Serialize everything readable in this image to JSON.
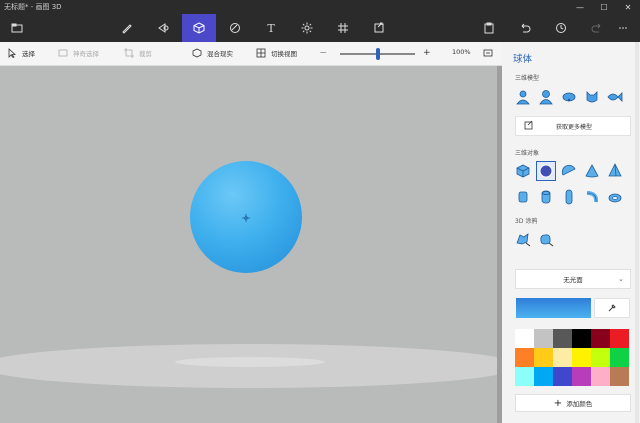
{
  "window": {
    "title": "无标题* - 画图 3D",
    "controls": [
      "—",
      "☐",
      "✕"
    ]
  },
  "toolbar": {
    "tools": [
      {
        "name": "menu",
        "icon": "folder-icon"
      },
      {
        "name": "brushes",
        "icon": "brush-icon"
      },
      {
        "name": "2d-shapes",
        "icon": "shapes-2d-icon"
      },
      {
        "name": "3d-shapes",
        "icon": "cube-icon",
        "active": true
      },
      {
        "name": "stickers",
        "icon": "sticker-icon"
      },
      {
        "name": "text",
        "icon": "text-icon"
      },
      {
        "name": "effects",
        "icon": "sun-icon"
      },
      {
        "name": "canvas",
        "icon": "canvas-icon"
      },
      {
        "name": "remix3d",
        "icon": "remix-icon"
      },
      {
        "name": "paste",
        "icon": "clipboard-icon"
      },
      {
        "name": "undo",
        "icon": "undo-icon"
      },
      {
        "name": "history",
        "icon": "history-icon"
      },
      {
        "name": "redo",
        "icon": "redo-icon"
      },
      {
        "name": "more",
        "icon": "more-icon"
      }
    ],
    "text_glyph": "T"
  },
  "subbar": {
    "select_label": "选择",
    "magic_select_label": "神奇选择",
    "crop_label": "裁剪",
    "mixed_reality_label": "混合现实",
    "view_3d_label": "切换视图",
    "zoom_minus": "—",
    "zoom_plus": "+",
    "zoom_level": "100%",
    "zoom_fraction": 0.5
  },
  "panel": {
    "title": "球体",
    "section_models": "三维模型",
    "open_3d_library": "获取更多模型",
    "section_objects": "三维对象",
    "section_doodle": "3D 涂鸦",
    "material_select": "无光面",
    "add_color": "添加颜色",
    "current_color": "#3aa5e8",
    "palette": [
      "#ffffff",
      "#c3c3c3",
      "#585858",
      "#000000",
      "#88001b",
      "#ec1c24",
      "#ff7f27",
      "#ffca18",
      "#fdeca6",
      "#fff200",
      "#c4ff0e",
      "#0ed145",
      "#8cfffb",
      "#00a8f3",
      "#3f48cc",
      "#b83dba",
      "#ffaec8",
      "#b97a56"
    ]
  }
}
